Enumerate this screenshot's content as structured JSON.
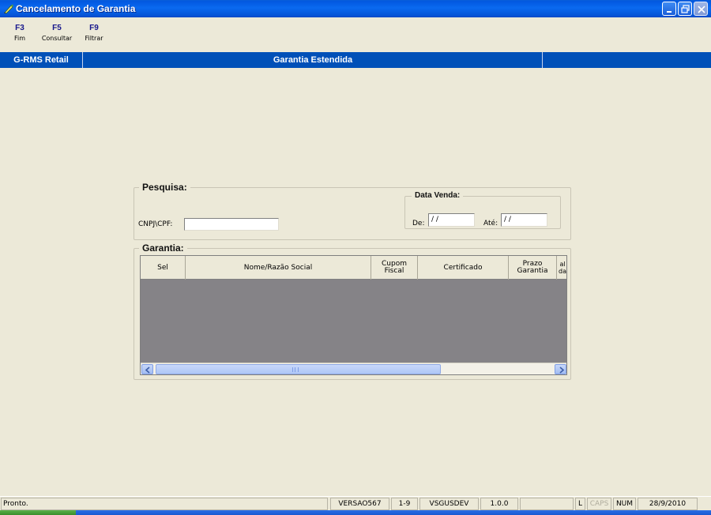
{
  "window": {
    "title": "Cancelamento de Garantia",
    "icons": {
      "app": "pen-icon",
      "minimize": "minimize-icon",
      "restore": "restore-icon",
      "close": "close-icon"
    }
  },
  "toolbar": {
    "items": [
      {
        "key": "F3",
        "label": "Fim"
      },
      {
        "key": "F5",
        "label": "Consultar"
      },
      {
        "key": "F9",
        "label": "Filtrar"
      }
    ]
  },
  "header": {
    "left": "G-RMS Retail",
    "center": "Garantia Estendida"
  },
  "pesquisa": {
    "title": "Pesquisa:",
    "cnpj_label": "CNPJ\\CPF:",
    "cnpj_value": "",
    "data_venda": {
      "title": "Data Venda:",
      "de_label": "De:",
      "de_value": " / /",
      "ate_label": "Até:",
      "ate_value": " / /"
    }
  },
  "garantia": {
    "title": "Garantia:",
    "columns": [
      "Sel",
      "Nome/Razão Social",
      "Cupom Fiscal",
      "Certificado",
      "Prazo Garantia",
      "al da"
    ],
    "rows": []
  },
  "statusbar": {
    "message": "Pronto.",
    "panels": [
      "VERSAO567",
      "1-9",
      "VSGUSDEV",
      "1.0.0",
      "",
      "L",
      "CAPS",
      "NUM",
      "28/9/2010"
    ]
  },
  "colors": {
    "titlebar": "#0a6af0",
    "header_band": "#0050b8",
    "background": "#ece9d8",
    "grid_empty": "#858387",
    "toolbar_key": "#17178c"
  }
}
